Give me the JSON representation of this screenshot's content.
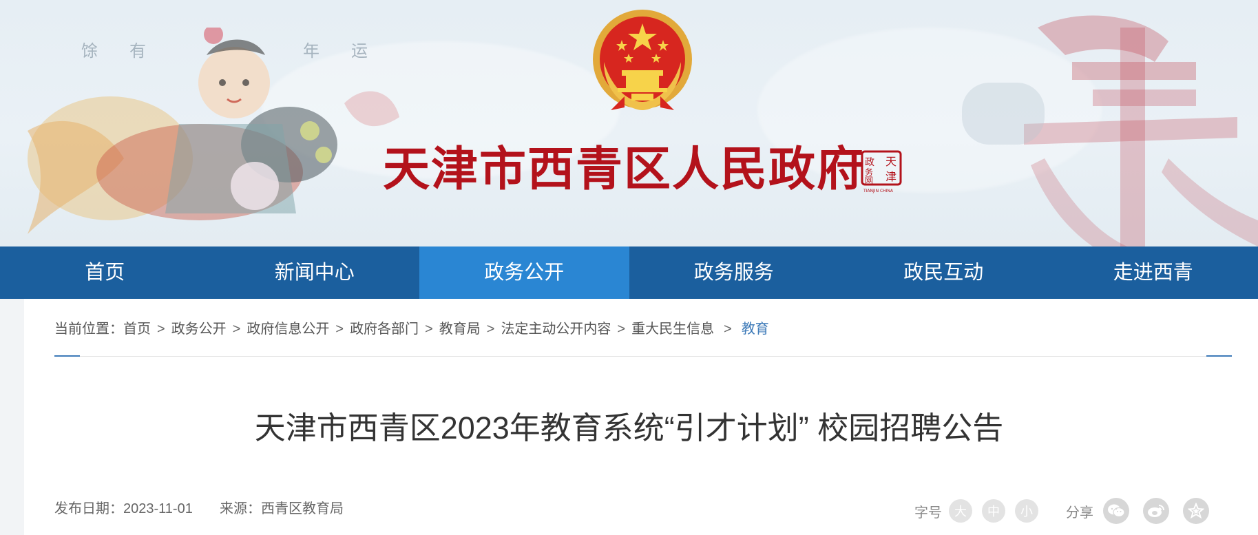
{
  "header": {
    "site_title": "天津市西青区人民政府",
    "calligraphy": [
      "馀",
      "有",
      "年",
      "运"
    ],
    "seal_text": [
      "天",
      "津",
      "政",
      "务",
      "网"
    ],
    "seal_caption": "TIANJIN CHINA"
  },
  "nav": {
    "items": [
      {
        "label": "首页"
      },
      {
        "label": "新闻中心"
      },
      {
        "label": "政务公开"
      },
      {
        "label": "政务服务"
      },
      {
        "label": "政民互动"
      },
      {
        "label": "走进西青"
      }
    ],
    "active_index": 2
  },
  "breadcrumb": {
    "prefix": "当前位置：",
    "items": [
      "首页",
      "政务公开",
      "政府信息公开",
      "政府各部门",
      "教育局",
      "法定主动公开内容",
      "重大民生信息"
    ],
    "separator": ">",
    "current": "教育"
  },
  "article": {
    "title": "天津市西青区2023年教育系统“引才计划” 校园招聘公告",
    "date_label": "发布日期：",
    "date": "2023-11-01",
    "source_label": "来源：",
    "source": "西青区教育局"
  },
  "tools": {
    "font_size_label": "字号",
    "font_sizes": [
      "大",
      "中",
      "小"
    ],
    "share_label": "分享",
    "share_icons": [
      "wechat-icon",
      "weibo-icon",
      "favorite-icon"
    ]
  },
  "colors": {
    "nav_bg": "#1b5f9e",
    "nav_active": "#2a86d3",
    "title_red": "#b3121b",
    "breadcrumb_current": "#3d7ab8"
  }
}
